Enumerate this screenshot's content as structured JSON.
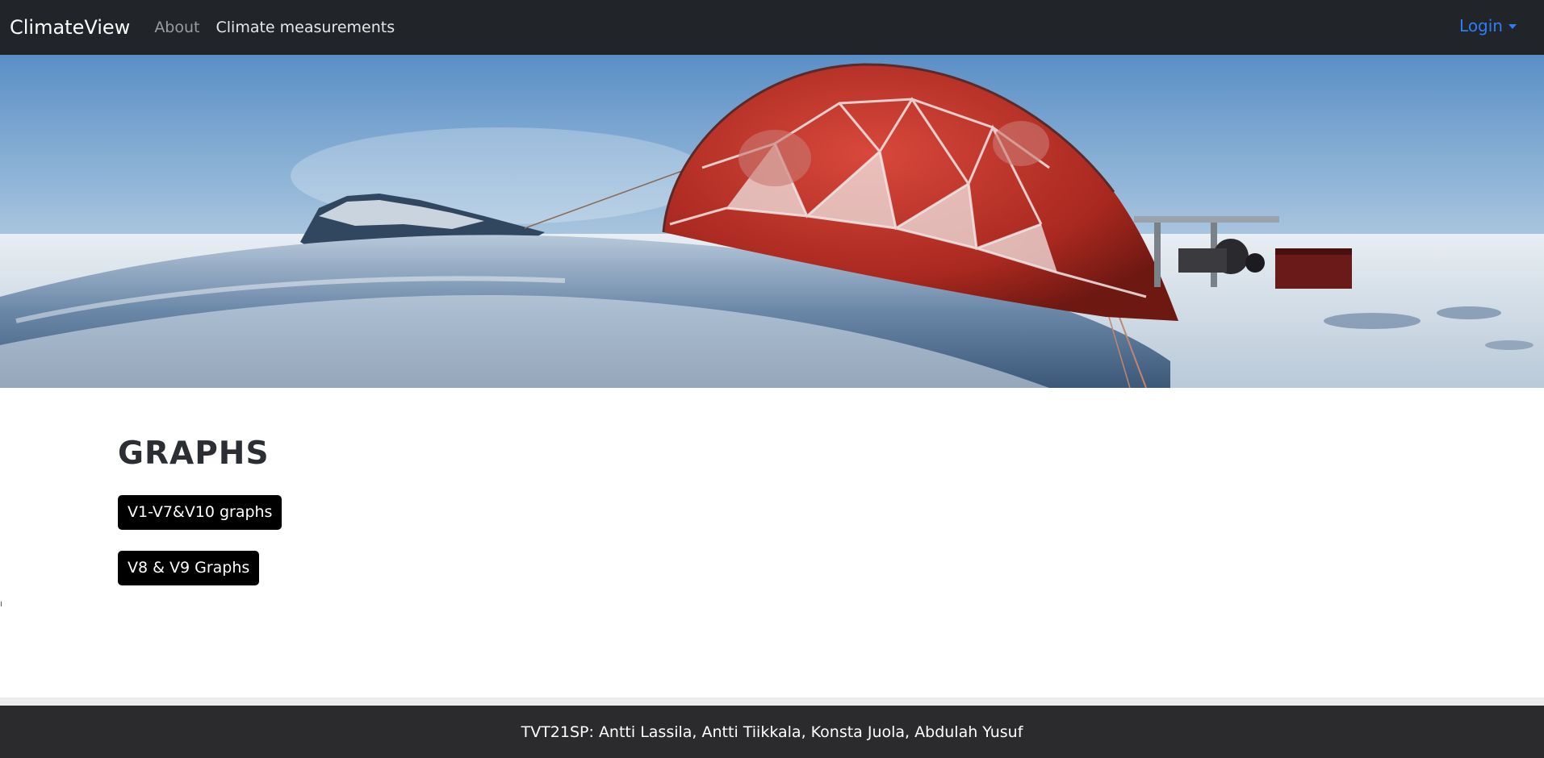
{
  "navbar": {
    "brand": "ClimateView",
    "links": [
      {
        "label": "About"
      },
      {
        "label": "Climate measurements"
      }
    ],
    "login_label": "Login"
  },
  "main": {
    "title": "GRAPHS",
    "buttons": [
      {
        "label": "V1-V7&V10 graphs"
      },
      {
        "label": "V8 & V9 Graphs"
      }
    ]
  },
  "footer": {
    "text": "TVT21SP: Antti Lassila, Antti Tiikkala, Konsta Juola, Abdulah Yusuf"
  },
  "colors": {
    "navbar_bg": "#212529",
    "login_link": "#2f7cf6",
    "button_bg": "#000000",
    "footer_bg": "#2b2b2d"
  }
}
